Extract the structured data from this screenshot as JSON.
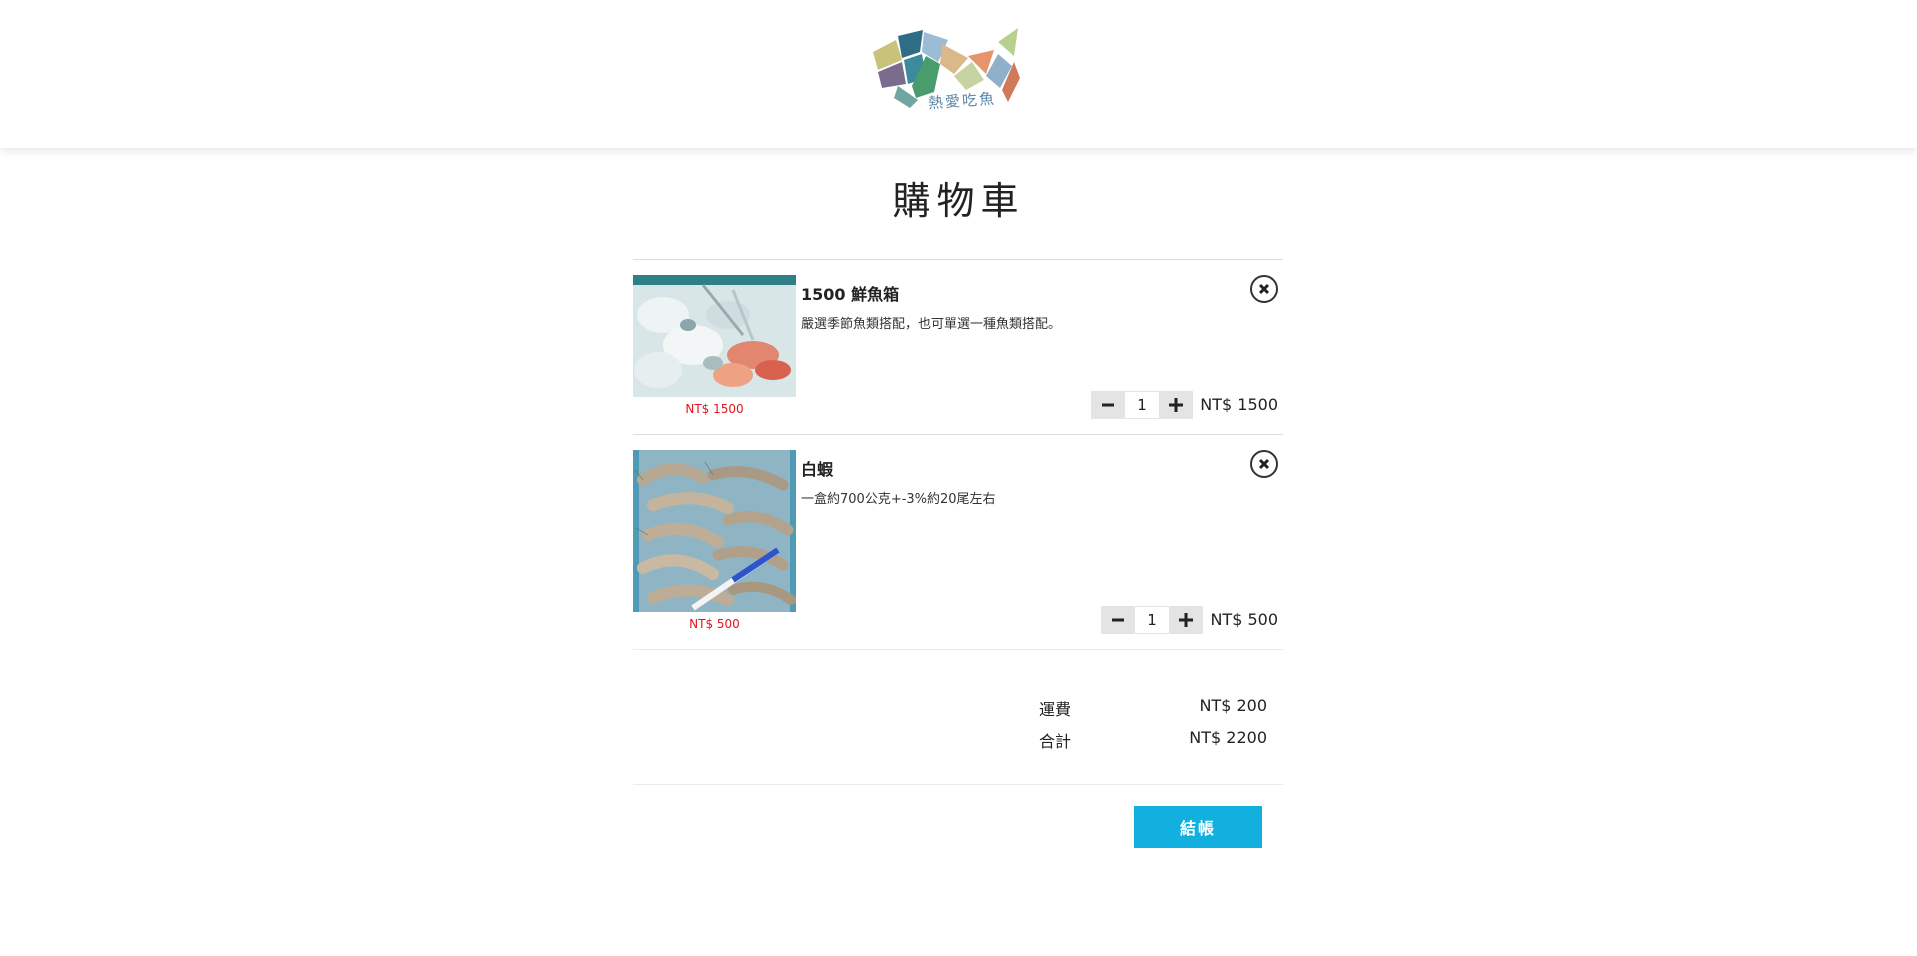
{
  "brand": {
    "logo_text": "熱愛吃魚"
  },
  "page": {
    "title": "購物車"
  },
  "items": [
    {
      "name": "1500 鮮魚箱",
      "description": "嚴選季節魚類搭配，也可單選一種魚類搭配。",
      "thumb_price": "NT$ 1500",
      "quantity": "1",
      "line_price": "NT$ 1500",
      "image_icon": "fish-box-photo"
    },
    {
      "name": "白蝦",
      "description": "一盒約700公克+-3%約20尾左右",
      "thumb_price": "NT$ 500",
      "quantity": "1",
      "line_price": "NT$ 500",
      "image_icon": "shrimp-photo"
    }
  ],
  "summary": {
    "shipping_label": "運費",
    "shipping_value": "NT$ 200",
    "total_label": "合計",
    "total_value": "NT$ 2200"
  },
  "checkout": {
    "label": "結帳"
  },
  "colors": {
    "accent": "#12b0df",
    "price_red": "#e0161e",
    "stepper_bg": "#e4e4e4"
  }
}
